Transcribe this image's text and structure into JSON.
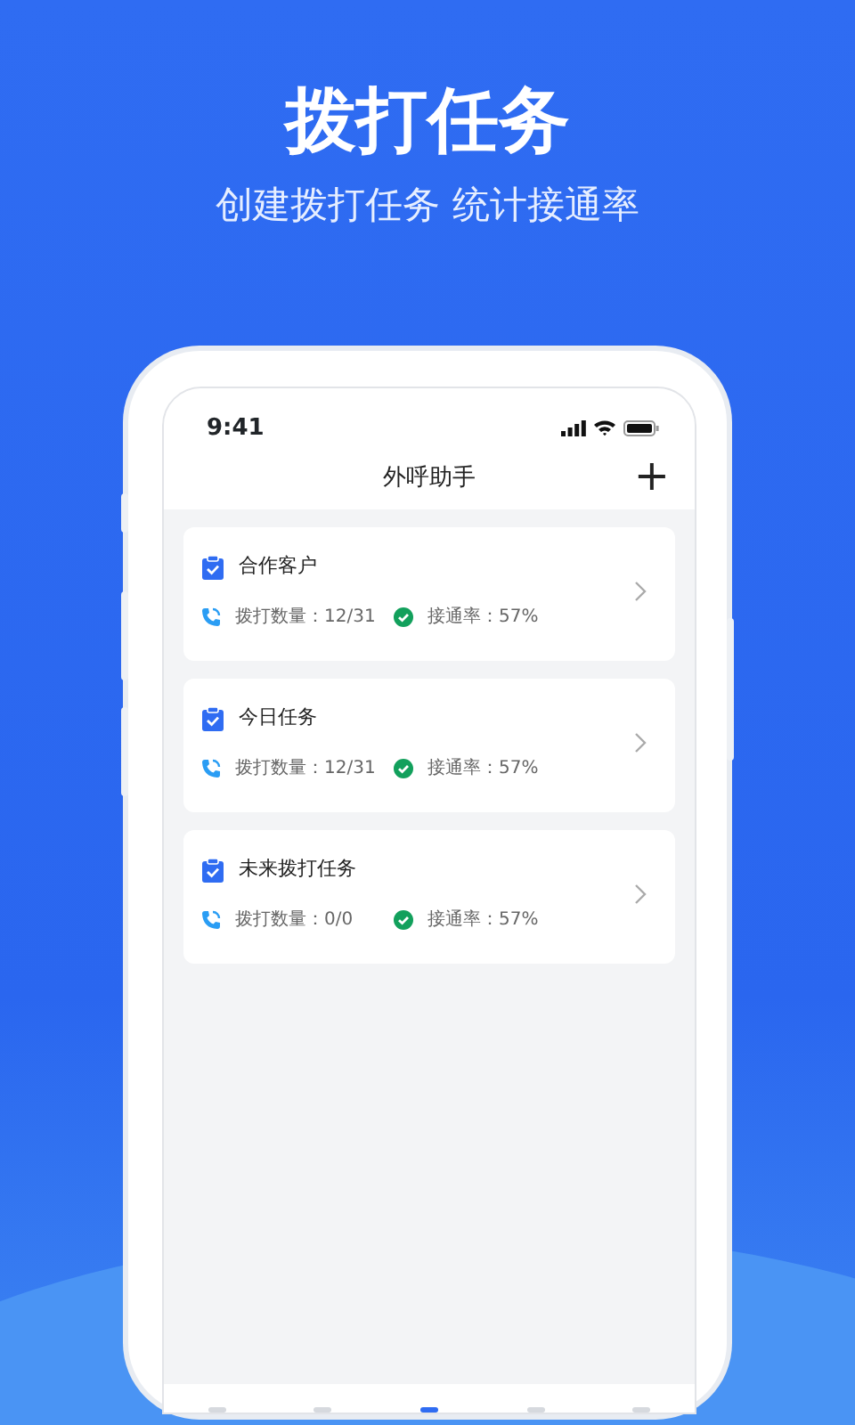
{
  "headline": "拨打任务",
  "subheadline": "创建拨打任务 统计接通率",
  "phone": {
    "status_bar": {
      "time": "9:41"
    },
    "nav_bar": {
      "title": "外呼助手",
      "action": "+"
    },
    "tasks": [
      {
        "name": "合作客户",
        "calls_label": "拨打数量：",
        "calls": "12/31",
        "rate_label": "接通率：",
        "rate": "57%"
      },
      {
        "name": "今日任务",
        "calls_label": "拨打数量：",
        "calls": "12/31",
        "rate_label": "接通率：",
        "rate": "57%"
      },
      {
        "name": "未来拨打任务",
        "calls_label": "拨打数量：",
        "calls": "0/0",
        "rate_label": "接通率：",
        "rate": "57%"
      }
    ],
    "tab_bar": [
      {
        "selected": false
      },
      {
        "selected": false
      },
      {
        "selected": true
      },
      {
        "selected": false
      },
      {
        "selected": false
      }
    ]
  }
}
